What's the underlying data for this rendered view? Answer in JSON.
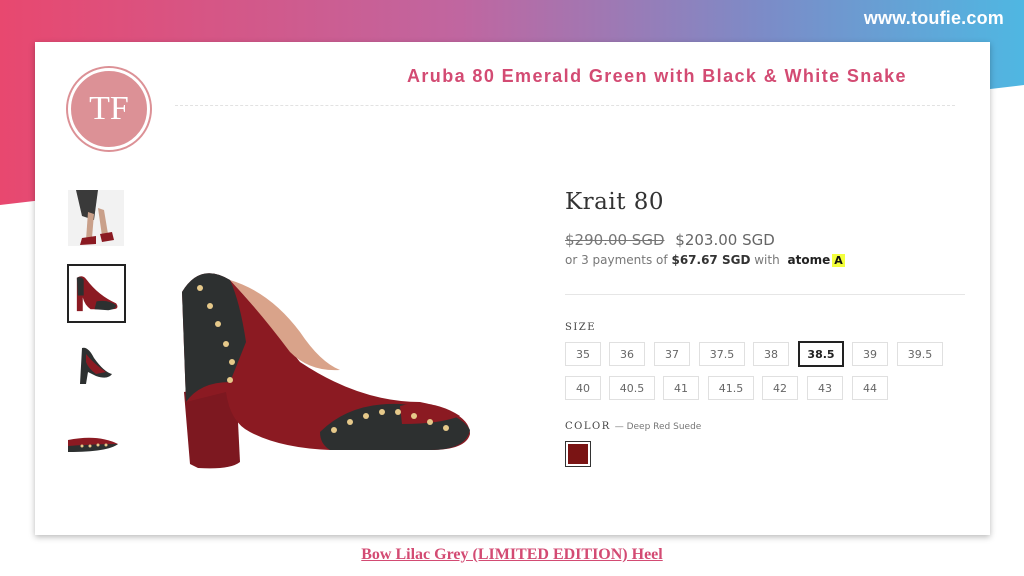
{
  "site": {
    "url": "www.toufie.com"
  },
  "header": {
    "logo_text": "TF",
    "title": "Aruba 80 Emerald Green with Black & White Snake"
  },
  "product": {
    "name": "Krait 80",
    "price_original": "$290.00 SGD",
    "price_sale": "$203.00 SGD",
    "installment_prefix": "or 3 payments of",
    "installment_amount": "$67.67 SGD",
    "installment_with": "with",
    "payment_provider": "atome",
    "size_label": "SIZE",
    "sizes": [
      "35",
      "36",
      "37",
      "37.5",
      "38",
      "38.5",
      "39",
      "39.5",
      "40",
      "40.5",
      "41",
      "41.5",
      "42",
      "43",
      "44"
    ],
    "selected_size": "38.5",
    "color_label": "COLOR",
    "color_value": "— Deep Red Suede",
    "color_swatch": "#7a1414"
  },
  "thumbnails": [
    {
      "icon": "model-legs-thumbnail"
    },
    {
      "icon": "shoe-side-thumbnail"
    },
    {
      "icon": "shoe-front-thumbnail"
    },
    {
      "icon": "shoe-toe-thumbnail"
    }
  ],
  "footer": {
    "link_text": "Bow Lilac Grey (LIMITED EDITION) Heel"
  },
  "colors": {
    "accent": "#d34b73",
    "shoe_red": "#8b1a22",
    "shoe_black": "#2d3030"
  }
}
